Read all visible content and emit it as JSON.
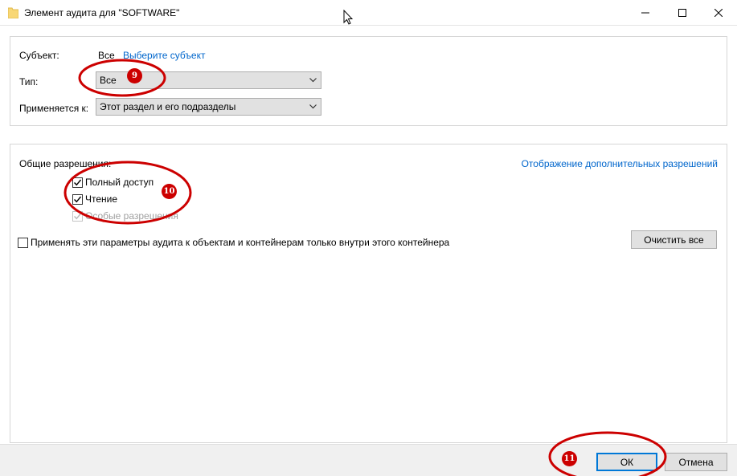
{
  "window": {
    "title": "Элемент аудита для \"SOFTWARE\"",
    "icon": "folder-icon"
  },
  "subject": {
    "label": "Субъект:",
    "value": "Все",
    "link": "Выберите субъект"
  },
  "type": {
    "label": "Тип:",
    "selected": "Все"
  },
  "applies_to": {
    "label": "Применяется к:",
    "selected": "Этот раздел и его подразделы"
  },
  "permissions": {
    "label": "Общие разрешения:",
    "show_advanced_link": "Отображение дополнительных разрешений",
    "items": [
      {
        "label": "Полный доступ",
        "checked": true,
        "enabled": true
      },
      {
        "label": "Чтение",
        "checked": true,
        "enabled": true
      },
      {
        "label": "Особые разрешения",
        "checked": true,
        "enabled": false
      }
    ],
    "clear_all": "Очистить все"
  },
  "apply_only_inside": {
    "label": "Применять эти параметры аудита к объектам и контейнерам только внутри этого контейнера",
    "checked": false
  },
  "footer": {
    "ok": "ОК",
    "cancel": "Отмена"
  },
  "annotations": [
    {
      "number": "9"
    },
    {
      "number": "10"
    },
    {
      "number": "11"
    }
  ],
  "colors": {
    "link": "#0066cc",
    "annotation": "#cc0000",
    "default_button_border": "#0078d7"
  }
}
